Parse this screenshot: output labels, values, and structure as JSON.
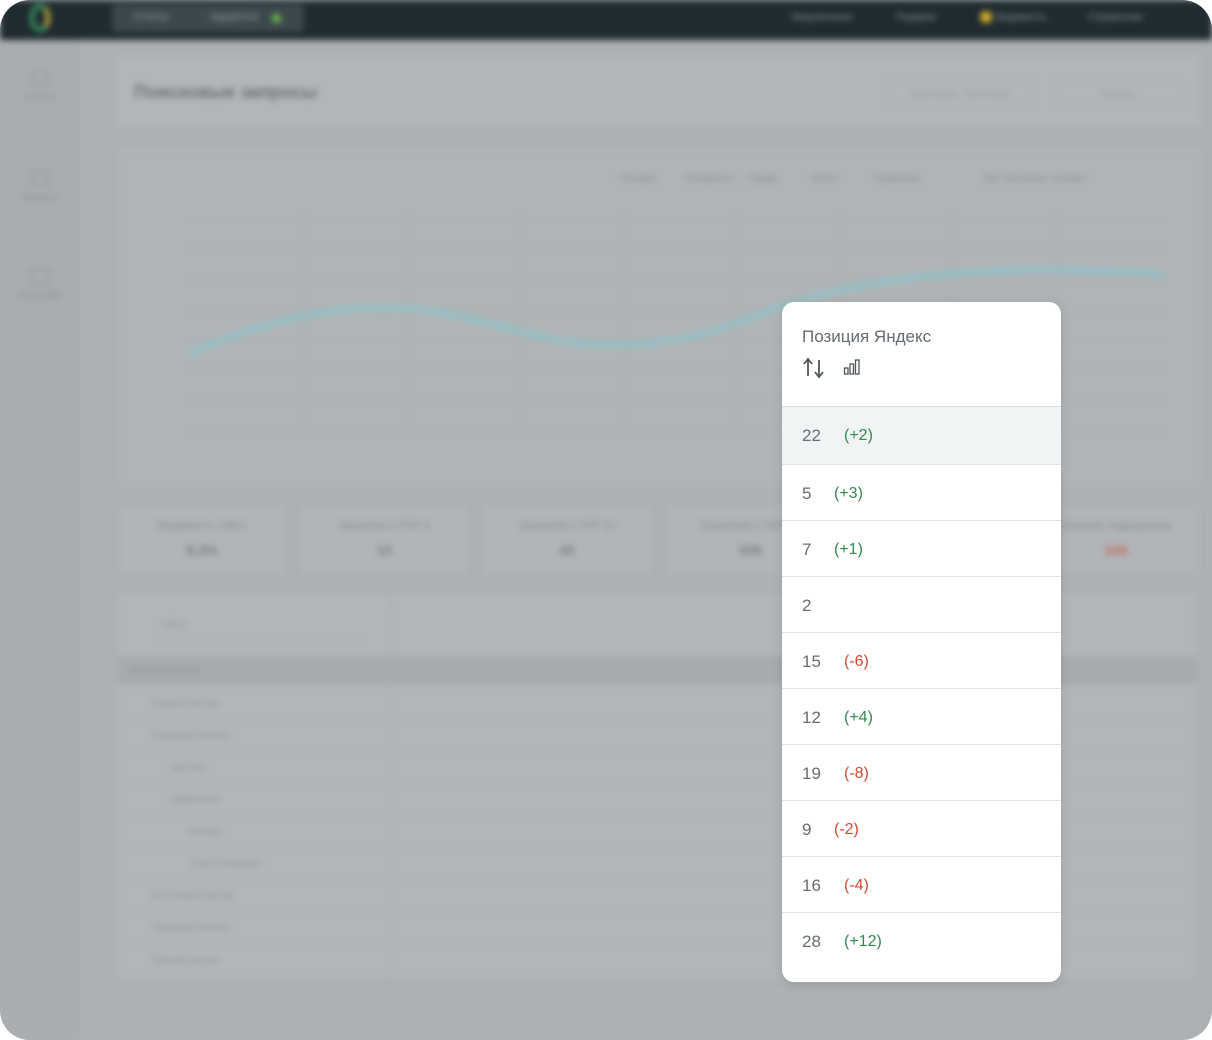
{
  "app": {
    "title": "Поисковые запросы",
    "tabs": [
      "Отчеты",
      "Заработок"
    ],
    "top_links": [
      "Уведомления",
      "Подарки",
      "Видимость",
      "Справочник"
    ],
    "sidebar": [
      "Отчеты",
      "Проекты",
      "Настройки"
    ],
    "header_buttons": [
      "01.07.2024 - 10.07.2024",
      "Скачать"
    ],
    "chart_tabs": [
      "История",
      "Конкуренты",
      "Города",
      "Метки",
      "Сравнение"
    ],
    "chart_filter": "Все поисковые системы",
    "stats": [
      {
        "label": "Видимость сайта",
        "value": "8,3%"
      },
      {
        "label": "Запросов в TOP 3",
        "value": "10"
      },
      {
        "label": "Запросов в TOP 10",
        "value": "45"
      },
      {
        "label": "Запросов в TOP 50",
        "value": "308"
      },
      {
        "label": "Позиция подрядчиков",
        "value": "106"
      }
    ],
    "table_rows": [
      "Итого в среднем",
      "Южный кластер",
      "Северный кластер",
      "Детское",
      "Мебельное",
      "Москва",
      "Санкт-Петербург",
      "Восточный кластер",
      "Западный кластер",
      "Прочий кластер"
    ],
    "search_placeholder": "Найти"
  },
  "popup": {
    "title": "Позиция Яндекс",
    "sort_icon": "sort-arrows-icon",
    "chart_icon": "bar-chart-icon",
    "rows": [
      {
        "value": "22",
        "delta": "(+2)",
        "trend": "up"
      },
      {
        "value": "5",
        "delta": "(+3)",
        "trend": "up"
      },
      {
        "value": "7",
        "delta": "(+1)",
        "trend": "up"
      },
      {
        "value": "2",
        "delta": "",
        "trend": "none"
      },
      {
        "value": "15",
        "delta": "(-6)",
        "trend": "down"
      },
      {
        "value": "12",
        "delta": "(+4)",
        "trend": "up"
      },
      {
        "value": "19",
        "delta": "(-8)",
        "trend": "down"
      },
      {
        "value": "9",
        "delta": "(-2)",
        "trend": "down"
      },
      {
        "value": "16",
        "delta": "(-4)",
        "trend": "down"
      },
      {
        "value": "28",
        "delta": "(+12)",
        "trend": "up"
      }
    ],
    "colors": {
      "up": "#2f8a4f",
      "down": "#d24a32",
      "highlight_row": "#f0f4f5"
    }
  }
}
